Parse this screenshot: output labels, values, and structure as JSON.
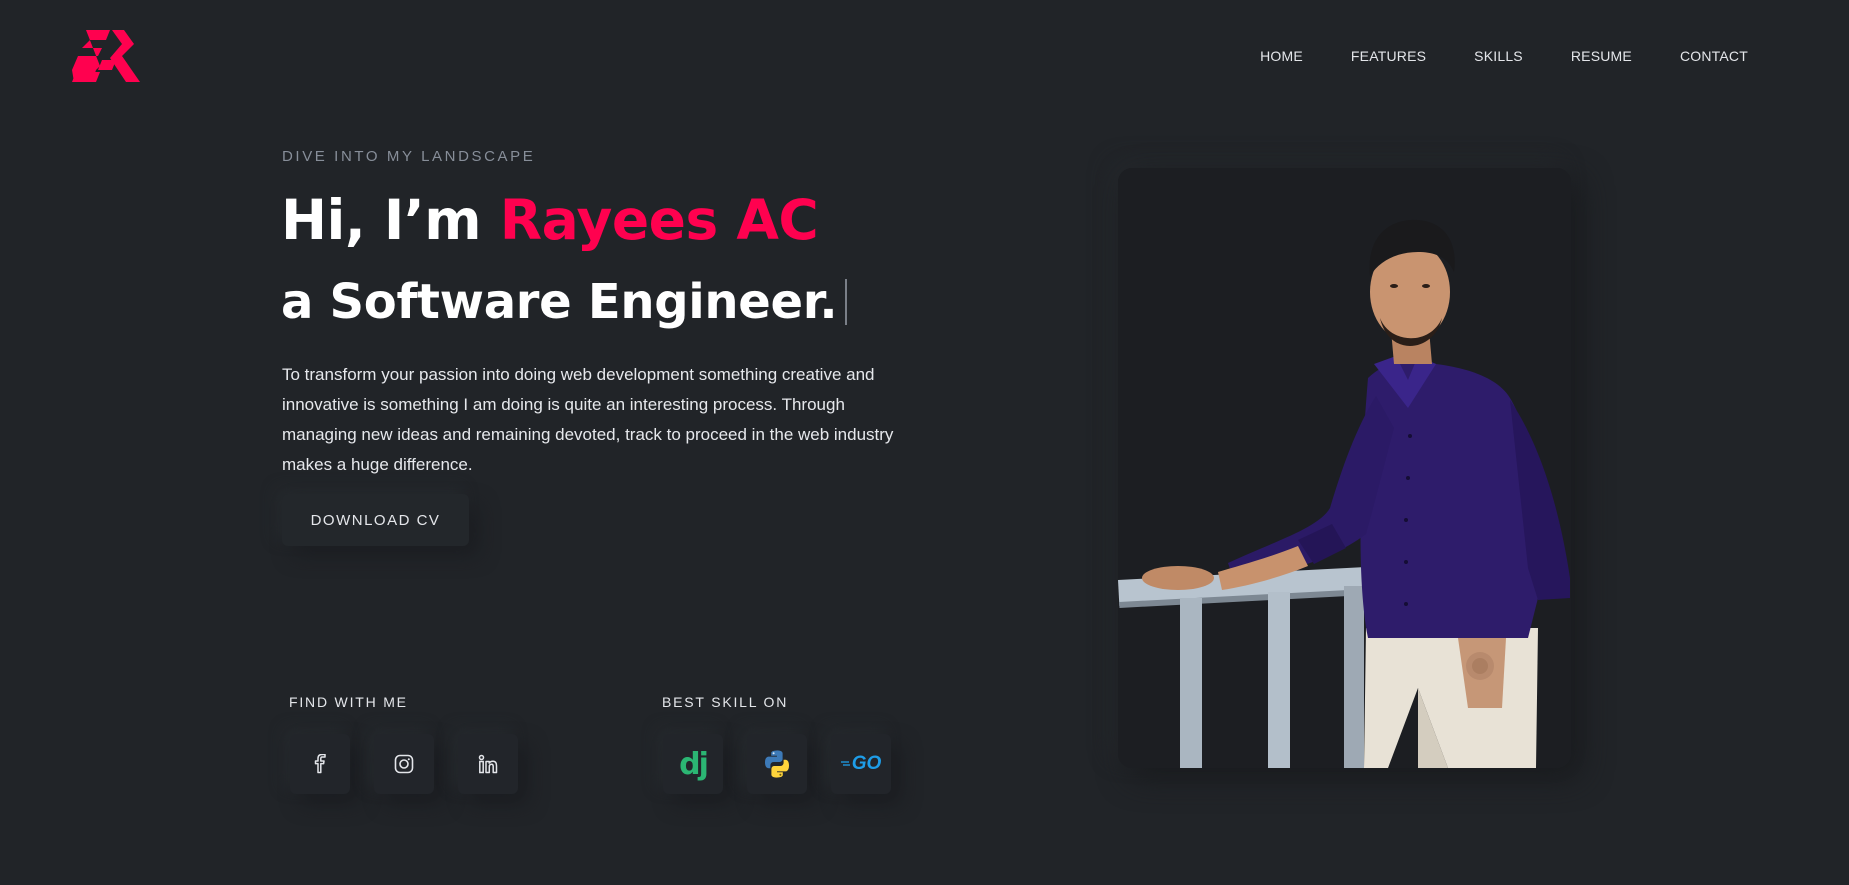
{
  "brand": {
    "logo_icon": "er-logo-icon",
    "accent_color": "#ff014f"
  },
  "nav": {
    "items": [
      {
        "label": "HOME"
      },
      {
        "label": "FEATURES"
      },
      {
        "label": "SKILLS"
      },
      {
        "label": "RESUME"
      },
      {
        "label": "CONTACT"
      }
    ]
  },
  "hero": {
    "kicker": "DIVE INTO MY LANDSCAPE",
    "greeting": "Hi, I’m ",
    "name": "Rayees AC",
    "role": "a Software Engineer.",
    "description": "To transform your passion into doing web development something creative and innovative is something I am doing is quite an interesting process. Through managing new ideas and remaining devoted, track to proceed in the web industry makes a huge difference.",
    "cta_label": "DOWNLOAD CV"
  },
  "social": {
    "title": "FIND WITH ME",
    "items": [
      {
        "icon": "facebook-icon"
      },
      {
        "icon": "instagram-icon"
      },
      {
        "icon": "linkedin-icon"
      }
    ]
  },
  "skills": {
    "title": "BEST SKILL ON",
    "items": [
      {
        "icon": "django-icon",
        "text": "dj",
        "color": "#2bb673"
      },
      {
        "icon": "python-icon"
      },
      {
        "icon": "go-icon",
        "text": "GO",
        "color": "#1e9de8"
      }
    ]
  },
  "portrait": {
    "icon": "profile-photo"
  }
}
